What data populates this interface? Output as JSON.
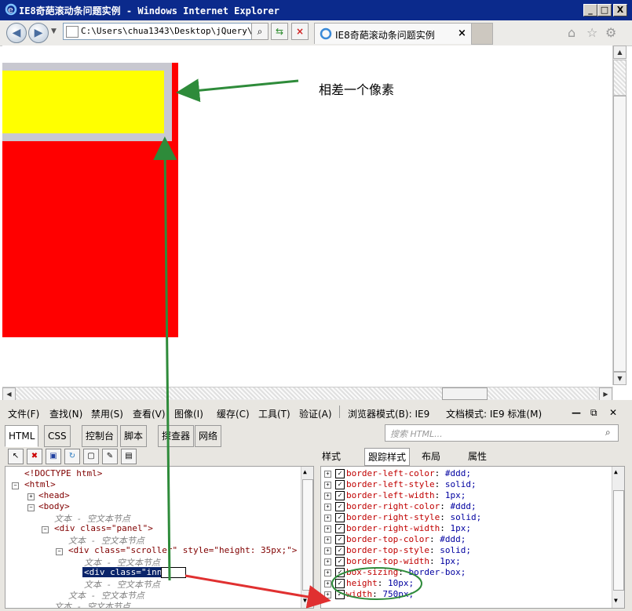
{
  "window": {
    "title": "IE8奇葩滚动条问题实例 - Windows Internet Explorer",
    "min": "_",
    "max": "□",
    "close": "X"
  },
  "nav": {
    "back": "◀",
    "forward": "▶",
    "address": "C:\\Users\\chua1343\\Desktop\\jQuery\\",
    "tab_title": "IE8奇葩滚动条问题实例",
    "tab_close": "×"
  },
  "page": {
    "annotation": "相差一个像素"
  },
  "devtools": {
    "menu": [
      "文件(F)",
      "查找(N)",
      "禁用(S)",
      "查看(V)",
      "图像(I)",
      "缓存(C)",
      "工具(T)",
      "验证(A)"
    ],
    "browser_mode": "浏览器模式(B): IE9",
    "doc_mode": "文档模式: IE9 标准(M)",
    "tabs": [
      "HTML",
      "CSS",
      "控制台",
      "脚本",
      "探查器",
      "网络"
    ],
    "search_placeholder": "搜索 HTML...",
    "right_tabs": [
      "样式",
      "跟踪样式",
      "布局",
      "属性"
    ],
    "tree": [
      "<!DOCTYPE html>",
      "<html>",
      "<head>",
      "<body>",
      "文本 - 空文本节点",
      "<div class=\"panel\">",
      "文本 - 空文本节点",
      "<div class=\"scroller\" style=\"height: 35px;\">",
      "文本 - 空文本节点",
      "<div class=\"inner",
      "文本 - 空文本节点",
      "文本 - 空文本节点",
      "文本 - 空文本节点"
    ],
    "styles": [
      {
        "prop": "border-left-color",
        "val": "#ddd;"
      },
      {
        "prop": "border-left-style",
        "val": "solid;"
      },
      {
        "prop": "border-left-width",
        "val": "1px;"
      },
      {
        "prop": "border-right-color",
        "val": "#ddd;"
      },
      {
        "prop": "border-right-style",
        "val": "solid;"
      },
      {
        "prop": "border-right-width",
        "val": "1px;"
      },
      {
        "prop": "border-top-color",
        "val": "#ddd;"
      },
      {
        "prop": "border-top-style",
        "val": "solid;"
      },
      {
        "prop": "border-top-width",
        "val": "1px;"
      },
      {
        "prop": "box-sizing",
        "val": "border-box;"
      },
      {
        "prop": "height",
        "val": "10px;"
      },
      {
        "prop": "width",
        "val": "750px;"
      }
    ]
  },
  "colors": {
    "yellow": "#ffff00",
    "red": "#ff0000",
    "arrow_green": "#2e8b3a",
    "arrow_red": "#e03030"
  }
}
